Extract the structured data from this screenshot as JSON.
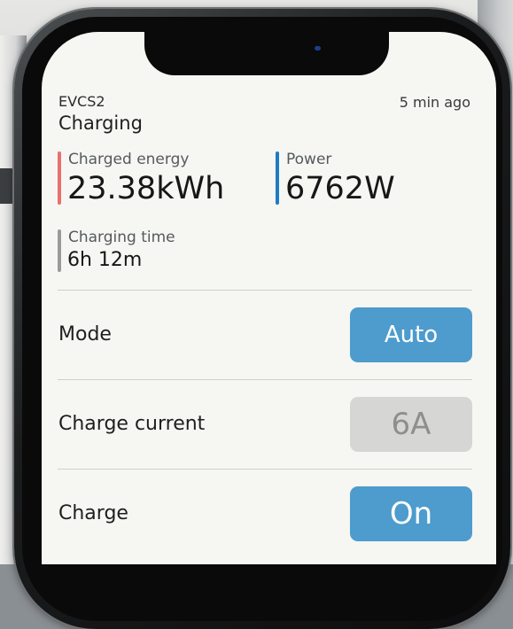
{
  "device": {
    "name": "EVCS2",
    "status": "Charging",
    "updated": "5 min ago"
  },
  "metrics": {
    "charged_energy": {
      "label": "Charged energy",
      "value": "23.38kWh",
      "accent": "#e8706e"
    },
    "power": {
      "label": "Power",
      "value": "6762W",
      "accent": "#1f7cc2"
    },
    "charging_time": {
      "label": "Charging time",
      "value": "6h 12m",
      "accent": "#9a9a9a"
    }
  },
  "controls": {
    "mode": {
      "label": "Mode",
      "button": "Auto"
    },
    "charge_current": {
      "label": "Charge current",
      "button": "6A"
    },
    "charge": {
      "label": "Charge",
      "button": "On"
    }
  },
  "colors": {
    "button_active": "#4d9ccd",
    "button_disabled": "#d6d6d4",
    "screen_background": "#f6f6f3"
  }
}
